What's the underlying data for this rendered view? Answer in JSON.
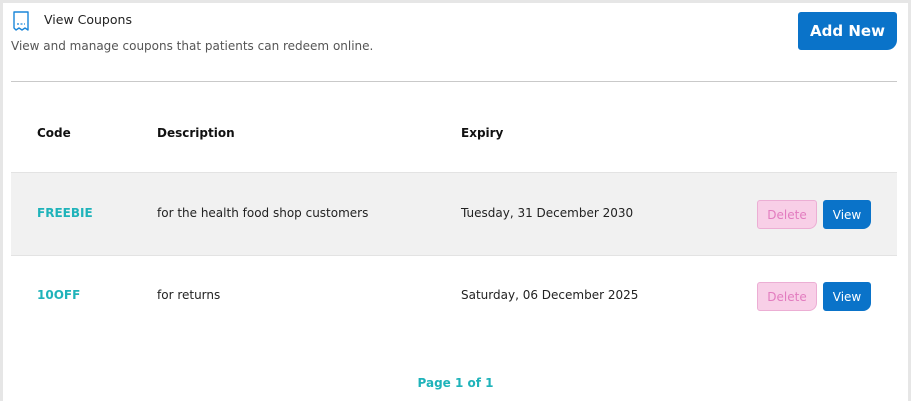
{
  "header": {
    "icon": "ticket-icon",
    "title": "View Coupons",
    "subtitle": "View and manage coupons that patients can redeem online.",
    "add_new_label": "Add New"
  },
  "table": {
    "columns": [
      "Code",
      "Description",
      "Expiry"
    ],
    "rows": [
      {
        "code": "FREEBIE",
        "description": "for the health food shop customers",
        "expiry": "Tuesday, 31 December 2030",
        "delete_label": "Delete",
        "view_label": "View"
      },
      {
        "code": "10OFF",
        "description": "for returns",
        "expiry": "Saturday, 06 December 2025",
        "delete_label": "Delete",
        "view_label": "View"
      }
    ]
  },
  "pagination": {
    "label": "Page 1 of 1"
  },
  "colors": {
    "accent_blue": "#0a73c9",
    "code_teal": "#1fb3ba",
    "delete_pink": "#f8cfe7"
  }
}
